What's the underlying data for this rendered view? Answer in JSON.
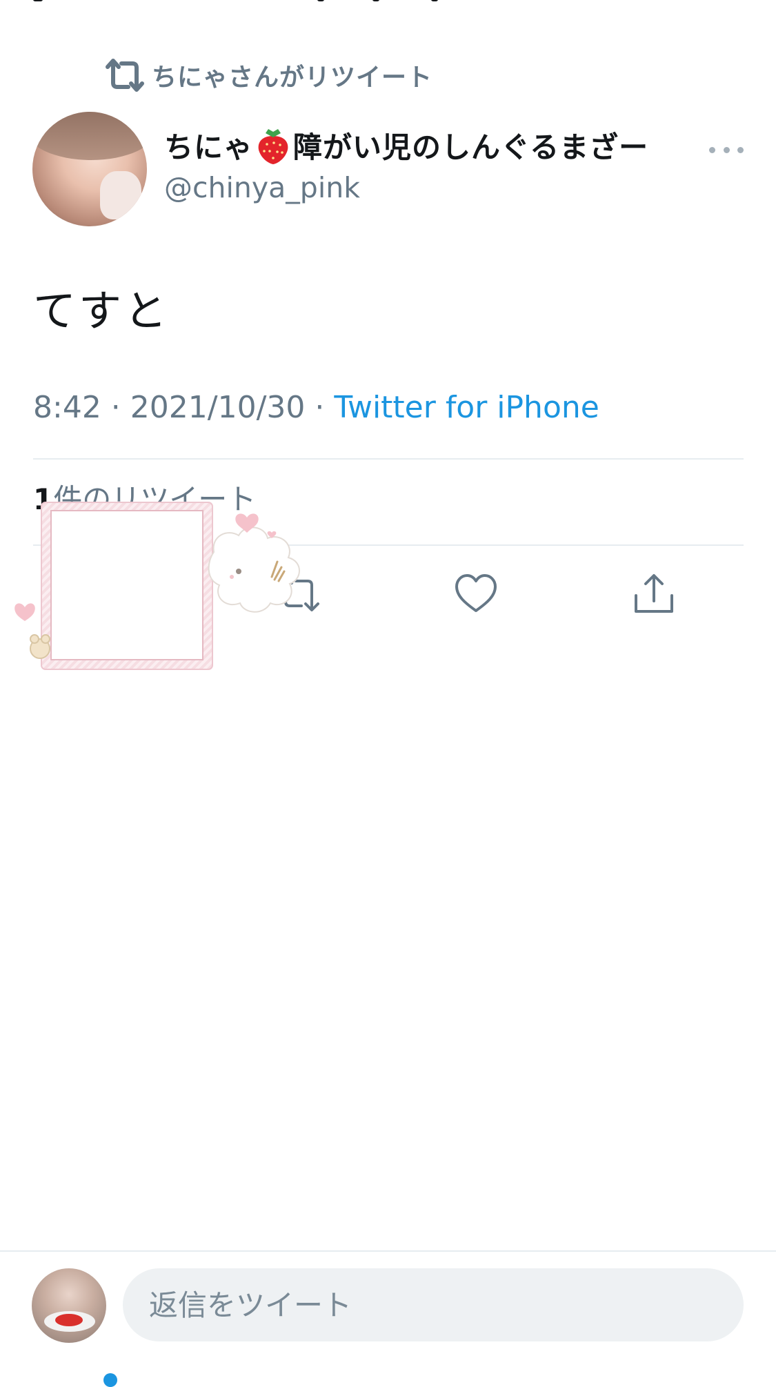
{
  "retweet_context": {
    "icon": "retweet-icon",
    "label": "ちにゃさんがリツイート"
  },
  "tweet": {
    "author": {
      "name_before_emoji": "ちにゃ",
      "emoji": "strawberry-emoji",
      "name_after_emoji": "障がい児のしんぐるまざー",
      "handle": "@chinya_pink"
    },
    "text": "てすと",
    "time": "8:42",
    "date": "2021/10/30",
    "separator": " · ",
    "source": "Twitter for iPhone"
  },
  "stats": {
    "retweet_count": "1",
    "retweet_label": "件のリツイート"
  },
  "actions": [
    {
      "icon": "reply-icon"
    },
    {
      "icon": "retweet-icon"
    },
    {
      "icon": "like-icon"
    },
    {
      "icon": "share-icon"
    }
  ],
  "reply_bar": {
    "placeholder": "返信をツイート"
  },
  "colors": {
    "text_primary": "#14171a",
    "text_secondary": "#657786",
    "link": "#1b95e0",
    "divider": "#e6ecf0",
    "input_bg": "#eef1f3"
  }
}
